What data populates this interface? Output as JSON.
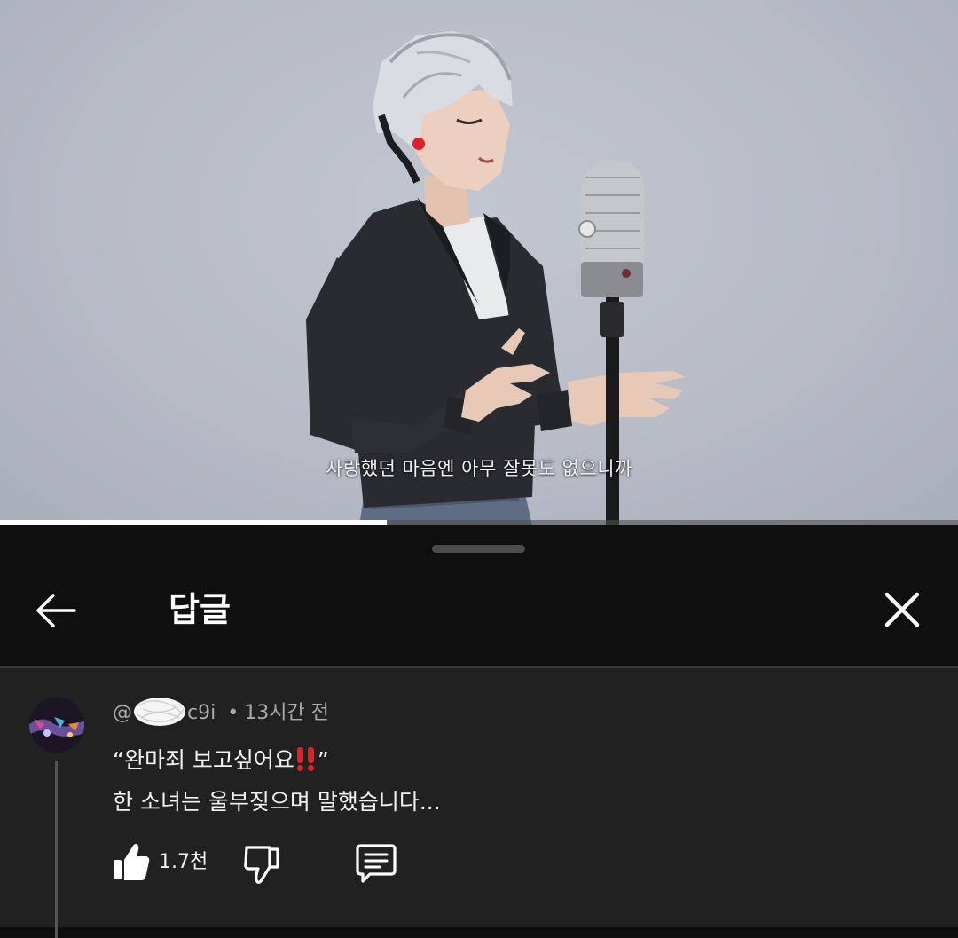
{
  "video": {
    "subtitle": "사랑했던 마음엔 아무 잘못도 없으니까",
    "progress_fraction": 0.404,
    "background_color": "#b8bdc8"
  },
  "sheet": {
    "title": "답글",
    "back_icon": "arrow-left-icon",
    "close_icon": "close-icon"
  },
  "comment": {
    "author_prefix": "@",
    "author_suffix": "c9i",
    "separator": "•",
    "time": "13시간 전",
    "line1_open": "“완마죄 보고싶어요",
    "line1_close": "”",
    "line2": "한 소녀는 울부짖으며 말했습니다...",
    "likes": "1.7천",
    "like_icon": "thumbs-up-icon",
    "dislike_icon": "thumbs-down-icon",
    "reply_icon": "reply-comment-icon"
  },
  "colors": {
    "sheet_bg": "#0f0f0f",
    "comment_bg": "#212121",
    "meta_text": "#aaaaaa",
    "primary_text": "#f1f1f1",
    "accent_red": "#e0202c"
  }
}
